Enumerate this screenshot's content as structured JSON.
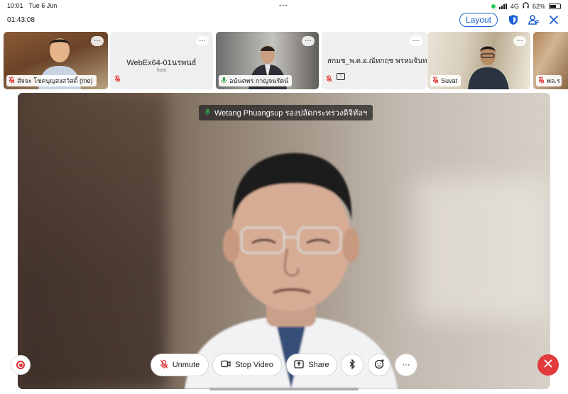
{
  "status_bar": {
    "time": "10:01",
    "date": "Tue 6 Jun",
    "network": "4G",
    "battery": "62%",
    "battery_level": 0.62
  },
  "header": {
    "elapsed": "01:43:08",
    "layout_label": "Layout"
  },
  "participants": [
    {
      "name": "สัจจะ โชคบุญสงสวัสดิ์ (me)",
      "video": true,
      "muted": true
    },
    {
      "name": "WebEx64-01นรพนธ์",
      "sub": "host",
      "video": false,
      "muted": true
    },
    {
      "name": "อนันตพร กาญจนรัตน์",
      "video": true,
      "muted": false
    },
    {
      "name": "สกมช_พ.ต.อ.ณัทกฤช พรหมจันทร์",
      "video": false,
      "muted": true,
      "sharing": true
    },
    {
      "name": "Suvat",
      "video": true,
      "muted": true
    },
    {
      "name": "พล.ร",
      "video": true,
      "muted": true
    }
  ],
  "active_speaker": {
    "name": "Wetang Phuangsup รองปลัดกระทรวงดิจิทัลฯ"
  },
  "controls": {
    "unmute": "Unmute",
    "stop_video": "Stop Video",
    "share": "Share",
    "more": "···"
  },
  "colors": {
    "accent": "#1a5fd6",
    "leave": "#e23b3b",
    "muted_icon": "#e03030",
    "unmuted_icon": "#2ea44f"
  }
}
